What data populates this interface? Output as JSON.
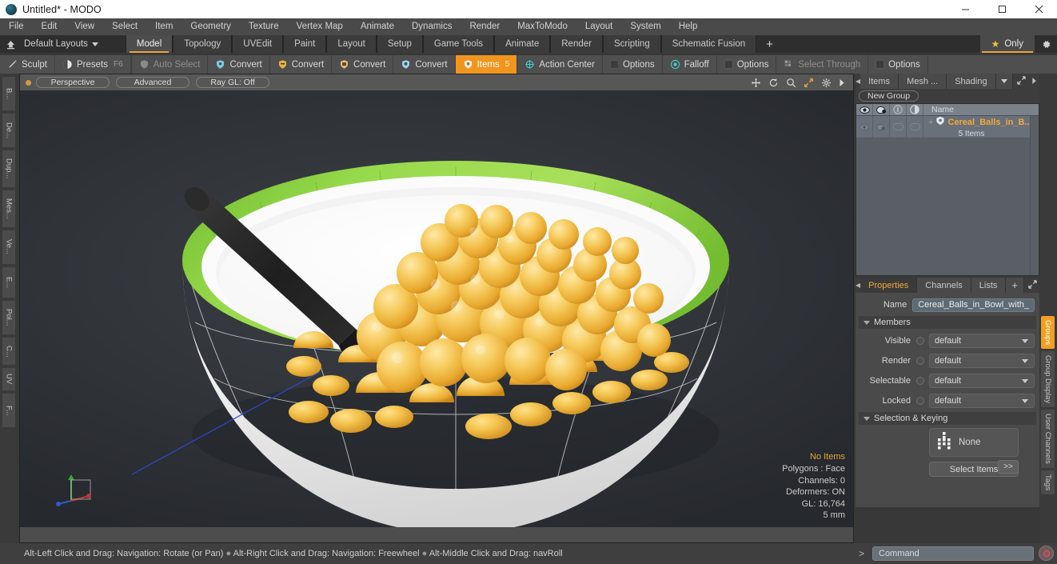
{
  "window": {
    "title": "Untitled* - MODO",
    "app_icon": "modo-logo-icon",
    "minimize": "minimize-icon",
    "maximize": "maximize-icon",
    "close": "close-icon"
  },
  "menubar": {
    "items": [
      {
        "label": "File"
      },
      {
        "label": "Edit"
      },
      {
        "label": "View"
      },
      {
        "label": "Select"
      },
      {
        "label": "Item"
      },
      {
        "label": "Geometry"
      },
      {
        "label": "Texture"
      },
      {
        "label": "Vertex Map"
      },
      {
        "label": "Animate"
      },
      {
        "label": "Dynamics"
      },
      {
        "label": "Render"
      },
      {
        "label": "MaxToModo"
      },
      {
        "label": "Layout"
      },
      {
        "label": "System"
      },
      {
        "label": "Help"
      }
    ]
  },
  "layoutbar": {
    "home_icon": "home-icon",
    "layouts_label": "Default Layouts",
    "tabs": [
      {
        "label": "Model",
        "active": true
      },
      {
        "label": "Topology",
        "active": false
      },
      {
        "label": "UVEdit",
        "active": false
      },
      {
        "label": "Paint",
        "active": false
      },
      {
        "label": "Layout",
        "active": false
      },
      {
        "label": "Setup",
        "active": false
      },
      {
        "label": "Game Tools",
        "active": false
      },
      {
        "label": "Animate",
        "active": false
      },
      {
        "label": "Render",
        "active": false
      },
      {
        "label": "Scripting",
        "active": false
      },
      {
        "label": "Schematic Fusion",
        "active": false
      }
    ],
    "add_tab": "+",
    "only_label": "Only",
    "only_star": "star-icon",
    "gear": "gear-icon"
  },
  "modebar": {
    "items": [
      {
        "label": "Sculpt",
        "icon": "brush-icon",
        "kbd": "",
        "state": "normal"
      },
      {
        "label": "Presets",
        "icon": "sphere-icon",
        "kbd": "F6",
        "state": "normal"
      },
      {
        "label": "Auto Select",
        "icon": "shield-icon",
        "kbd": "",
        "state": "dim"
      },
      {
        "label": "Convert",
        "icon": "vertex-icon",
        "kbd": "",
        "state": "normal"
      },
      {
        "label": "Convert",
        "icon": "edge-icon",
        "kbd": "",
        "state": "normal"
      },
      {
        "label": "Convert",
        "icon": "polygon-icon",
        "kbd": "",
        "state": "normal"
      },
      {
        "label": "Convert",
        "icon": "material-icon",
        "kbd": "",
        "state": "normal"
      },
      {
        "label": "Items",
        "icon": "items-icon",
        "kbd": "5",
        "state": "active"
      },
      {
        "label": "Action Center",
        "icon": "target-icon",
        "kbd": "",
        "state": "normal"
      },
      {
        "label": "Options",
        "icon": "checkbox-icon",
        "kbd": "",
        "state": "normal"
      },
      {
        "label": "Falloff",
        "icon": "falloff-icon",
        "kbd": "",
        "state": "normal"
      },
      {
        "label": "Options",
        "icon": "checkbox-icon",
        "kbd": "",
        "state": "normal"
      },
      {
        "label": "Select Through",
        "icon": "selectthrough-icon",
        "kbd": "",
        "state": "dim"
      },
      {
        "label": "Options",
        "icon": "checkbox-icon",
        "kbd": "",
        "state": "normal"
      }
    ]
  },
  "left_tabs": [
    {
      "label": "B..."
    },
    {
      "label": "De..."
    },
    {
      "label": "Dup..."
    },
    {
      "label": "Mes..."
    },
    {
      "label": "Ve..."
    },
    {
      "label": "E..."
    },
    {
      "label": "Pol..."
    },
    {
      "label": "C..."
    },
    {
      "label": "UV"
    },
    {
      "label": "F..."
    }
  ],
  "viewport": {
    "dot": "active-view-indicator",
    "pills": [
      "Perspective",
      "Advanced",
      "Ray GL: Off"
    ],
    "tools": [
      "move-icon",
      "rotate-icon",
      "zoom-icon",
      "fit-icon",
      "gear-icon",
      "chevron-right-icon"
    ],
    "stats": {
      "no_items": "No Items",
      "polygons": "Polygons : Face",
      "channels": "Channels: 0",
      "deformers": "Deformers: ON",
      "gl": "GL: 16,764",
      "scale": "5 mm"
    },
    "axis_gizmo": "axis-gizmo-icon",
    "model": {
      "name": "Cereal Balls in Bowl with Spoon",
      "bowl_color": "#f2f2f2",
      "rim_color": "#8fd13f",
      "cereal_color": "#f0b93c",
      "spoon_color": "#262626",
      "milk_color": "#fafafa"
    }
  },
  "right_panel": {
    "top_tabs": [
      {
        "label": "Items",
        "active": false
      },
      {
        "label": "Mesh ...",
        "active": false
      },
      {
        "label": "Shading",
        "active": false
      }
    ],
    "top_tab_caret": "chevron-down-icon",
    "expand_icon": "expand-icon",
    "more_icon": "chevron-right-icon",
    "new_group_button": "New Group",
    "item_list": {
      "columns": [
        "eye-icon",
        "render-icon",
        "lock-icon",
        "shading-icon"
      ],
      "name_header": "Name",
      "rows": [
        {
          "label": "Cereal_Balls_in_B...",
          "sub": "5 Items",
          "icon": "group-icon",
          "expander": "+"
        }
      ]
    },
    "properties": {
      "tabs": [
        {
          "label": "Properties",
          "active": true
        },
        {
          "label": "Channels",
          "active": false
        },
        {
          "label": "Lists",
          "active": false
        }
      ],
      "add": "+",
      "expand_icon": "expand-icon",
      "gear_icon": "gear-icon",
      "more_icon": "chevron-right-icon",
      "name_label": "Name",
      "name_value": "Cereal_Balls_in_Bowl_with_",
      "members_section": "Members",
      "fields": [
        {
          "label": "Visible",
          "value": "default"
        },
        {
          "label": "Render",
          "value": "default"
        },
        {
          "label": "Selectable",
          "value": "default"
        },
        {
          "label": "Locked",
          "value": "default"
        }
      ],
      "selection_section": "Selection & Keying",
      "selection_value": "None",
      "selection_icon": "items-grid-icon",
      "select_items_button": "Select Items",
      "more_button": ">>"
    },
    "side_tabs": [
      {
        "label": "Groups",
        "active": true
      },
      {
        "label": "Group Display",
        "active": false
      },
      {
        "label": "User Channels",
        "active": false
      },
      {
        "label": "Tags",
        "active": false
      }
    ]
  },
  "statusbar": {
    "hint_1": "Alt-Left Click and Drag: Navigation: Rotate (or Pan)",
    "sep": "●",
    "hint_2": "Alt-Right Click and Drag: Navigation: Freewheel",
    "hint_3": "Alt-Middle Click and Drag: navRoll",
    "command_prompt": ">",
    "command_placeholder": "Command",
    "record_button": "record-icon"
  },
  "colors": {
    "accent_orange": "#f0a83c",
    "active_tab_orange": "#f0961e",
    "panel_bg": "#4a4a4a",
    "viewport_bg": "#2c2f33"
  }
}
